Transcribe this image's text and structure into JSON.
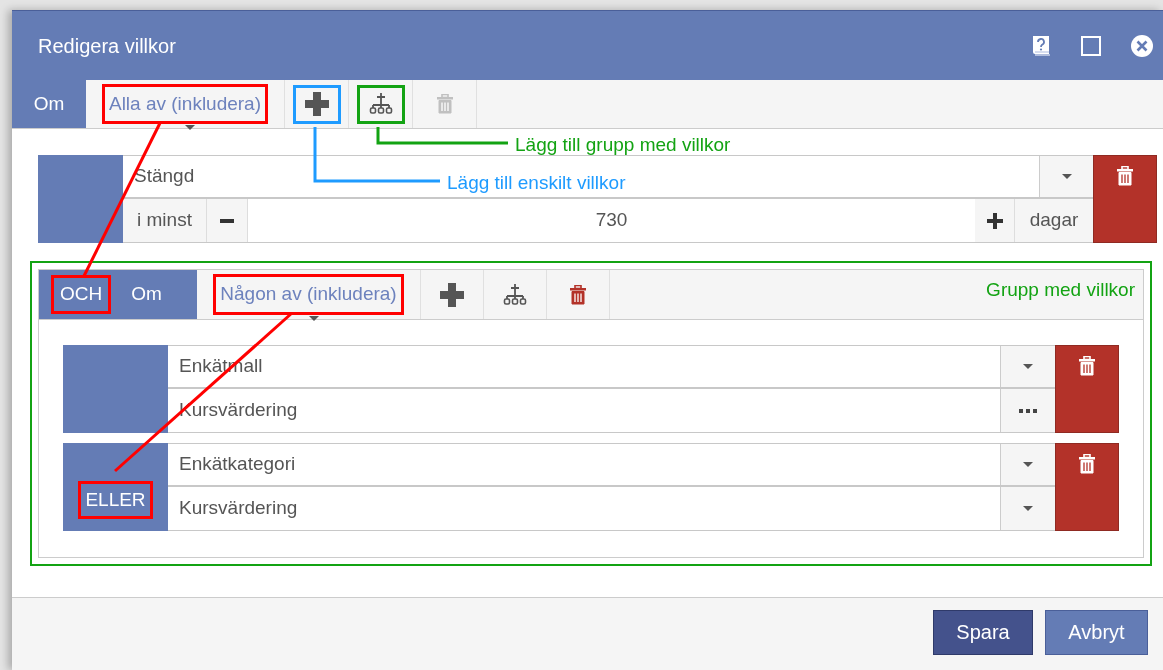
{
  "window": {
    "title": "Redigera villkor"
  },
  "toolbar": {
    "prefix": "Om",
    "mode": {
      "label": "Alla av (inkludera)",
      "color": "#ff0000"
    },
    "buttons": [
      {
        "kind": "add",
        "disabled": false,
        "color": "#1e9bff"
      },
      {
        "kind": "add-group",
        "disabled": false,
        "color": "#13a313"
      },
      {
        "kind": "delete",
        "disabled": true
      }
    ]
  },
  "callouts": [
    {
      "text": "Lägg till grupp med villkor",
      "color": "#13a313"
    },
    {
      "text": "Lägg till enskilt villkor",
      "color": "#1e9bff"
    }
  ],
  "conditions": [
    {
      "kind": "duration",
      "field": "Stängd",
      "qualifier": "i minst",
      "value": "730",
      "unit": "dagar"
    }
  ],
  "group": {
    "label": "Grupp med villkor",
    "color": "#13a313",
    "operator": {
      "label": "OCH",
      "color": "#ff0000"
    },
    "prefix": "Om",
    "mode": {
      "label": "Någon av (inkludera)",
      "color": "#ff0000"
    },
    "buttons": [
      {
        "kind": "add",
        "disabled": false
      },
      {
        "kind": "add-group",
        "disabled": false
      },
      {
        "kind": "delete",
        "disabled": false
      }
    ],
    "conditions": [
      {
        "kind": "lookup",
        "field": "Enkätmall",
        "value": "Kursvärdering",
        "value_button": {
          "kind": "picker"
        }
      },
      {
        "kind": "lookup",
        "operator": {
          "label": "ELLER",
          "color": "#ff0000"
        },
        "field": "Enkätkategori",
        "value": "Kursvärdering",
        "value_button": {
          "kind": "dropdown"
        }
      }
    ]
  },
  "footer": {
    "buttons": [
      {
        "label": "Spara",
        "primary": true
      },
      {
        "label": "Avbryt",
        "primary": false
      }
    ]
  }
}
